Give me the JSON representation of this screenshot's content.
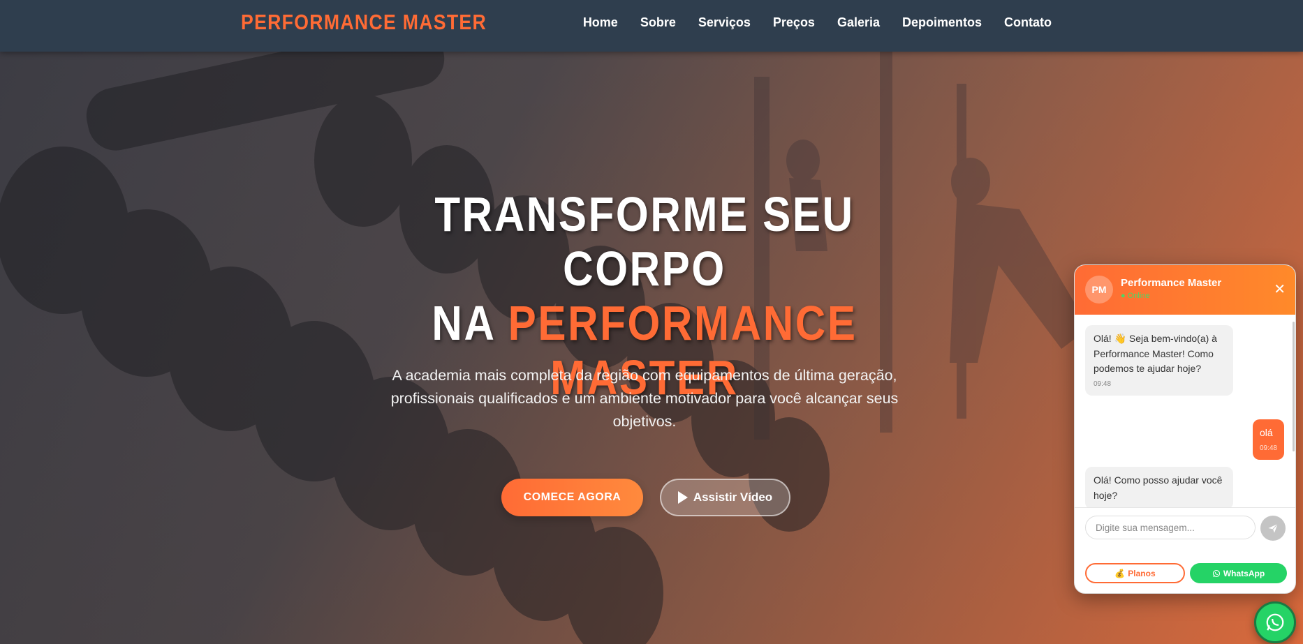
{
  "nav": {
    "brand": "PERFORMANCE MASTER",
    "items": [
      "Home",
      "Sobre",
      "Serviços",
      "Preços",
      "Galeria",
      "Depoimentos",
      "Contato"
    ]
  },
  "hero": {
    "title_line1": "TRANSFORME SEU CORPO",
    "title_line2_prefix": "NA ",
    "title_line2_accent": "PERFORMANCE",
    "title_line3_accent": "MASTER",
    "subtitle": "A academia mais completa da região com equipamentos de última geração, profissionais qualificados e um ambiente motivador para você alcançar seus objetivos.",
    "primary_button": "COMECE AGORA",
    "secondary_button": "Assistir Vídeo",
    "secondary_button_icon": "play-icon"
  },
  "chat": {
    "avatar_initials": "PM",
    "name": "Performance Master",
    "status": "● Online",
    "close_label": "✕",
    "messages": [
      {
        "from": "bot",
        "text": "Olá! 👋 Seja bem-vindo(a) à Performance Master! Como podemos te ajudar hoje?",
        "time": "09:48"
      },
      {
        "from": "user",
        "text": "olá",
        "time": "09:48"
      },
      {
        "from": "bot",
        "text": "Olá! Como posso ajudar você hoje?",
        "time": ""
      }
    ],
    "input_placeholder": "Digite sua mensagem...",
    "send_icon": "paper-plane-icon",
    "chip_planos": "Planos",
    "chip_planos_icon": "💰",
    "chip_whatsapp": "WhatsApp",
    "chip_whatsapp_icon": "whatsapp-icon"
  },
  "floating": {
    "icon": "whatsapp-icon"
  },
  "colors": {
    "accent": "#ff6b35",
    "nav_bg": "#2f3e4e",
    "whatsapp": "#25d366",
    "online": "#4cd964"
  }
}
